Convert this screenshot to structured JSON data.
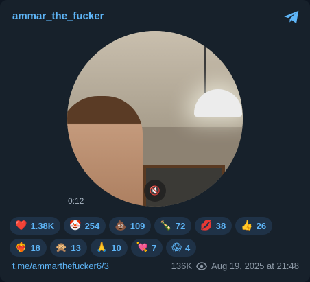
{
  "post": {
    "channel_name": "ammar_the_fucker",
    "video_duration": "0:12",
    "link": "t.me/ammarthefucker6/3",
    "views": "136K",
    "timestamp": "Aug 19, 2025 at 21:48"
  },
  "reactions": [
    {
      "emoji": "❤️",
      "count": "1.38K"
    },
    {
      "emoji": "🤡",
      "count": "254"
    },
    {
      "emoji": "💩",
      "count": "109"
    },
    {
      "emoji": "🍾",
      "count": "72"
    },
    {
      "emoji": "💋",
      "count": "38"
    },
    {
      "emoji": "👍",
      "count": "26"
    },
    {
      "emoji": "❤️‍🔥",
      "count": "18"
    },
    {
      "emoji": "🙊",
      "count": "13"
    },
    {
      "emoji": "🙏",
      "count": "10"
    },
    {
      "emoji": "💘",
      "count": "7"
    },
    {
      "emoji": "😱",
      "count": "4"
    }
  ],
  "colors": {
    "accent": "#5eb5f7",
    "card_bg": "#17212b",
    "reaction_bg": "#1f3247",
    "muted_text": "#8d99a6"
  },
  "icons": {
    "header": "telegram-icon",
    "video": "muted-speaker-icon",
    "views": "eye-icon"
  }
}
